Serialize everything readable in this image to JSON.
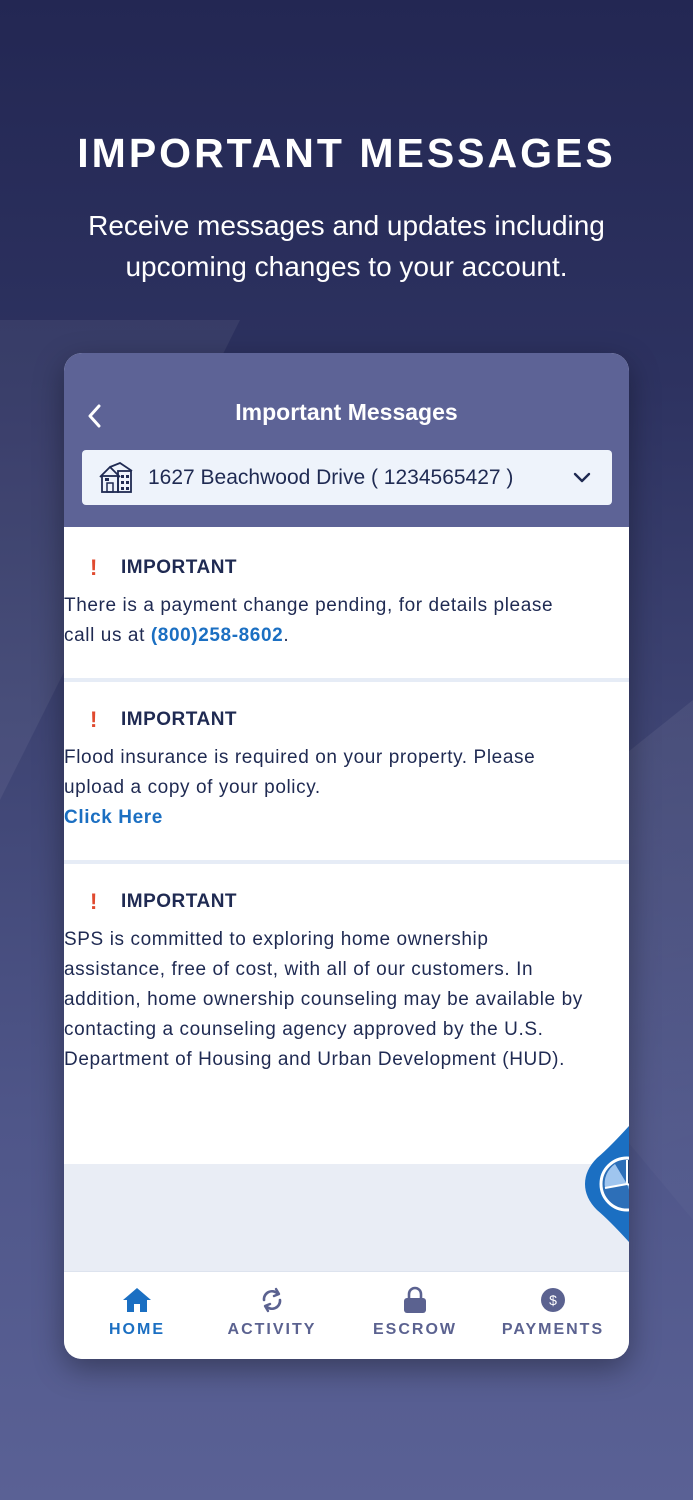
{
  "hero": {
    "title": "IMPORTANT MESSAGES",
    "subtitle": "Receive messages and updates including upcoming changes to your account."
  },
  "header": {
    "title": "Important Messages",
    "back_icon": "chevron-left-icon"
  },
  "property_selector": {
    "icon": "house-icon",
    "value": "1627 Beachwood Drive ( 1234565427 )",
    "dropdown_icon": "chevron-down-icon"
  },
  "messages": [
    {
      "marker": "!",
      "label": "IMPORTANT",
      "text": "There is a payment change pending, for details please call us at ",
      "link": "(800)258-8602",
      "suffix": "."
    },
    {
      "marker": "!",
      "label": "IMPORTANT",
      "text": "Flood insurance is required on your property. Please upload a copy of your policy.",
      "link": "Click Here"
    },
    {
      "marker": "!",
      "label": "IMPORTANT",
      "text": "SPS is committed to exploring home ownership assistance, free of cost, with all of our customers. In addition, home ownership counseling may be available by contacting a counseling agency approved by the U.S. Department of Housing and Urban Development (HUD)."
    }
  ],
  "tabbar": {
    "items": [
      {
        "label": "HOME",
        "icon": "home-icon",
        "active": true
      },
      {
        "label": "ACTIVITY",
        "icon": "refresh-icon",
        "active": false
      },
      {
        "label": "ESCROW",
        "icon": "lock-icon",
        "active": false
      },
      {
        "label": "PAYMENTS",
        "icon": "dollar-icon",
        "active": false
      }
    ]
  },
  "colors": {
    "header_bg": "#5d6396",
    "accent_blue": "#1b6fc2",
    "alert_red": "#e04a2f",
    "text_navy": "#1f2a52"
  }
}
